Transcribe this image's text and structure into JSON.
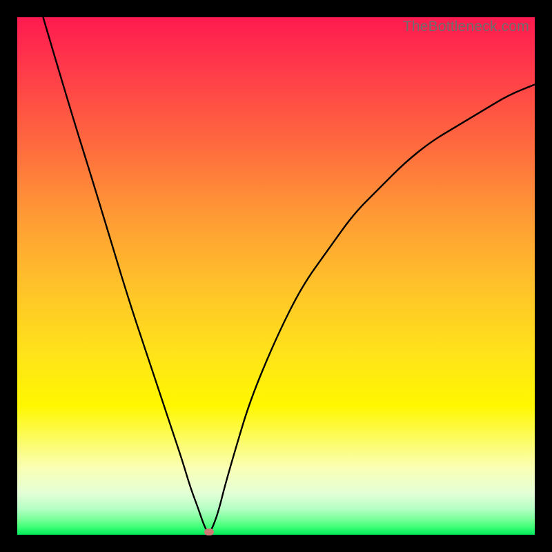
{
  "watermark": "TheBottleneck.com",
  "colors": {
    "frame": "#000000",
    "marker": "#cc7a73",
    "curve": "#000000"
  },
  "chart_data": {
    "type": "line",
    "title": "",
    "xlabel": "",
    "ylabel": "",
    "xlim": [
      0,
      100
    ],
    "ylim": [
      0,
      100
    ],
    "grid": false,
    "marker": {
      "x": 37,
      "y": 0
    },
    "series": [
      {
        "name": "bottleneck-curve",
        "x": [
          5,
          10,
          15,
          18,
          22,
          25,
          28,
          30,
          32,
          33.5,
          35,
          36,
          37,
          38,
          39,
          40,
          42,
          45,
          50,
          55,
          60,
          65,
          70,
          75,
          80,
          85,
          90,
          95,
          100
        ],
        "values": [
          100,
          83,
          67,
          57,
          44,
          35,
          26,
          20,
          14,
          9,
          5,
          2,
          0,
          2,
          5,
          9,
          16,
          26,
          38,
          48,
          55,
          62,
          67,
          72,
          76,
          79,
          82,
          85,
          87
        ]
      }
    ],
    "gradient_stops": [
      {
        "pct": 0,
        "color": "#ff1a4f"
      },
      {
        "pct": 0.25,
        "color": "#ff6b3e"
      },
      {
        "pct": 0.52,
        "color": "#ffc22a"
      },
      {
        "pct": 0.75,
        "color": "#fff700"
      },
      {
        "pct": 0.92,
        "color": "#e4ffd6"
      },
      {
        "pct": 1.0,
        "color": "#00e85a"
      }
    ]
  }
}
